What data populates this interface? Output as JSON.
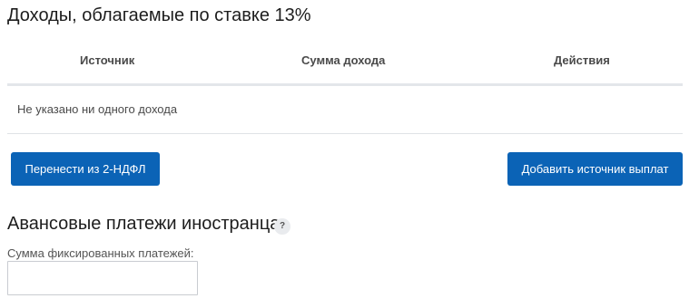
{
  "income_section": {
    "title": "Доходы, облагаемые по ставке 13%",
    "table": {
      "columns": [
        "Источник",
        "Сумма дохода",
        "Действия"
      ],
      "empty_message": "Не указано ни одного дохода"
    },
    "buttons": {
      "import_label": "Перенести из 2-НДФЛ",
      "add_label": "Добавить источник выплат"
    }
  },
  "advance_section": {
    "title": "Авансовые платежи иностранца",
    "help_icon": "question-mark-icon",
    "help_glyph": "?",
    "field": {
      "label": "Сумма фиксированных платежей:",
      "value": "",
      "placeholder": ""
    }
  },
  "colors": {
    "button_primary": "#0b63b6",
    "button_text": "#ffffff",
    "table_divider": "#e3e6ea"
  }
}
